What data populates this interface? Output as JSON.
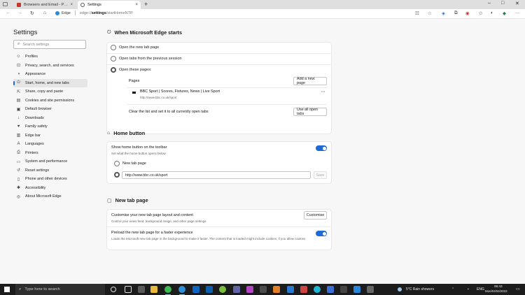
{
  "browser": {
    "tabs": [
      {
        "title": "Browsers and Email - Post New",
        "active": false
      },
      {
        "title": "Settings",
        "active": true
      }
    ],
    "new_tab_glyph": "+",
    "tab_close_glyph": "×",
    "window_controls": {
      "minimize": "–",
      "maximize": "□",
      "close": "✕"
    },
    "address": {
      "site_label": "Edge",
      "url_prefix": "edge://",
      "url_bold": "settings",
      "url_suffix": "/startHomeNTP"
    }
  },
  "sidebar": {
    "title": "Settings",
    "search_placeholder": "Search settings",
    "items": [
      {
        "label": "Profiles",
        "icon": "profile-icon"
      },
      {
        "label": "Privacy, search, and services",
        "icon": "lock-icon"
      },
      {
        "label": "Appearance",
        "icon": "appearance-icon"
      },
      {
        "label": "Start, home, and new tabs",
        "icon": "power-icon",
        "active": true
      },
      {
        "label": "Share, copy and paste",
        "icon": "share-icon"
      },
      {
        "label": "Cookies and site permissions",
        "icon": "cookie-icon"
      },
      {
        "label": "Default browser",
        "icon": "browser-icon"
      },
      {
        "label": "Downloads",
        "icon": "download-icon"
      },
      {
        "label": "Family safety",
        "icon": "family-icon"
      },
      {
        "label": "Edge bar",
        "icon": "edge-bar-icon"
      },
      {
        "label": "Languages",
        "icon": "language-icon"
      },
      {
        "label": "Printers",
        "icon": "printer-icon"
      },
      {
        "label": "System and performance",
        "icon": "system-icon"
      },
      {
        "label": "Reset settings",
        "icon": "reset-icon"
      },
      {
        "label": "Phone and other devices",
        "icon": "phone-icon"
      },
      {
        "label": "Accessibility",
        "icon": "accessibility-icon"
      },
      {
        "label": "About Microsoft Edge",
        "icon": "edge-icon"
      }
    ]
  },
  "startup": {
    "heading": "When Microsoft Edge starts",
    "options": [
      {
        "label": "Open the new tab page",
        "selected": false
      },
      {
        "label": "Open tabs from the previous session",
        "selected": false
      },
      {
        "label": "Open these pages:",
        "selected": true
      }
    ],
    "pages_label": "Pages",
    "add_page_button": "Add a new page",
    "page": {
      "title": "BBC Sport | Scores, Fixtures, News | Live Sport",
      "url": "http://www.bbc.co.uk/sport",
      "more": "···"
    },
    "clear_label": "Clear the list and set it to all currently open tabs",
    "use_all_tabs_button": "Use all open tabs"
  },
  "home": {
    "heading": "Home button",
    "toggle_label": "Show home button on the toolbar",
    "toggle_desc": "Set what the home button opens below",
    "toggle_on": true,
    "new_tab_option": "New tab page",
    "url_value": "http://www.bbc.co.uk/sport",
    "save_button": "Save"
  },
  "newtab": {
    "heading": "New tab page",
    "customise_title": "Customise your new tab page layout and content",
    "customise_desc": "Control your news feed, background image, and other page settings",
    "customise_button": "Customise",
    "preload_title": "Preload the new tab page for a faster experience",
    "preload_desc": "Loads the Microsoft new tab page in the background to make it faster. The content that is loaded might include cookies, if you allow cookies",
    "preload_on": true
  },
  "taskbar": {
    "search_placeholder": "Type here to search",
    "weather": "5°C  Rain showers",
    "language": "ENG",
    "time": "06:43",
    "date": "Mon/04/04/2022"
  },
  "colors": {
    "accent": "#1f6ad6",
    "taskbar": "#1c1c1c"
  }
}
